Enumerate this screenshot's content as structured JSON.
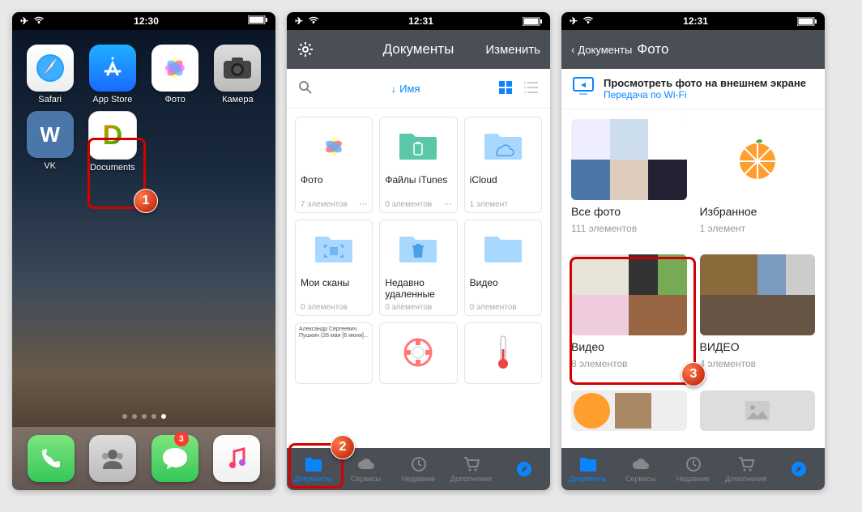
{
  "screen1": {
    "time": "12:30",
    "apps": [
      {
        "name": "Safari"
      },
      {
        "name": "App Store"
      },
      {
        "name": "Фото"
      },
      {
        "name": "Камера"
      },
      {
        "name": "VK"
      },
      {
        "name": "Documents"
      }
    ],
    "dock_msg_badge": "3"
  },
  "screen2": {
    "time": "12:31",
    "title": "Документы",
    "edit": "Изменить",
    "sort": "Имя",
    "folders": [
      {
        "name": "Фото",
        "meta": "7 элементов"
      },
      {
        "name": "Файлы iTunes",
        "meta": "0 элементов"
      },
      {
        "name": "iCloud",
        "meta": "1 элемент"
      },
      {
        "name": "Мои сканы",
        "meta": "0 элементов"
      },
      {
        "name": "Недавно удаленные",
        "meta": "0 элементов"
      },
      {
        "name": "Видео",
        "meta": "0 элементов"
      }
    ],
    "tabs": [
      "Документы",
      "Сервисы",
      "Недавние",
      "Дополнения",
      ""
    ]
  },
  "screen3": {
    "time": "12:31",
    "back": "Документы",
    "title": "Фото",
    "banner_title": "Просмотреть фото на внешнем экране",
    "banner_sub": "Передача по Wi-Fi",
    "albums": [
      {
        "name": "Все фото",
        "count": "111 элементов"
      },
      {
        "name": "Избранное",
        "count": "1 элемент"
      },
      {
        "name": "Видео",
        "count": "8 элементов"
      },
      {
        "name": "ВИДЕО",
        "count": "4 элементов"
      }
    ],
    "tabs": [
      "Документы",
      "Сервисы",
      "Недавние",
      "Дополнения",
      ""
    ]
  },
  "annotations": {
    "n1": "1",
    "n2": "2",
    "n3": "3"
  }
}
